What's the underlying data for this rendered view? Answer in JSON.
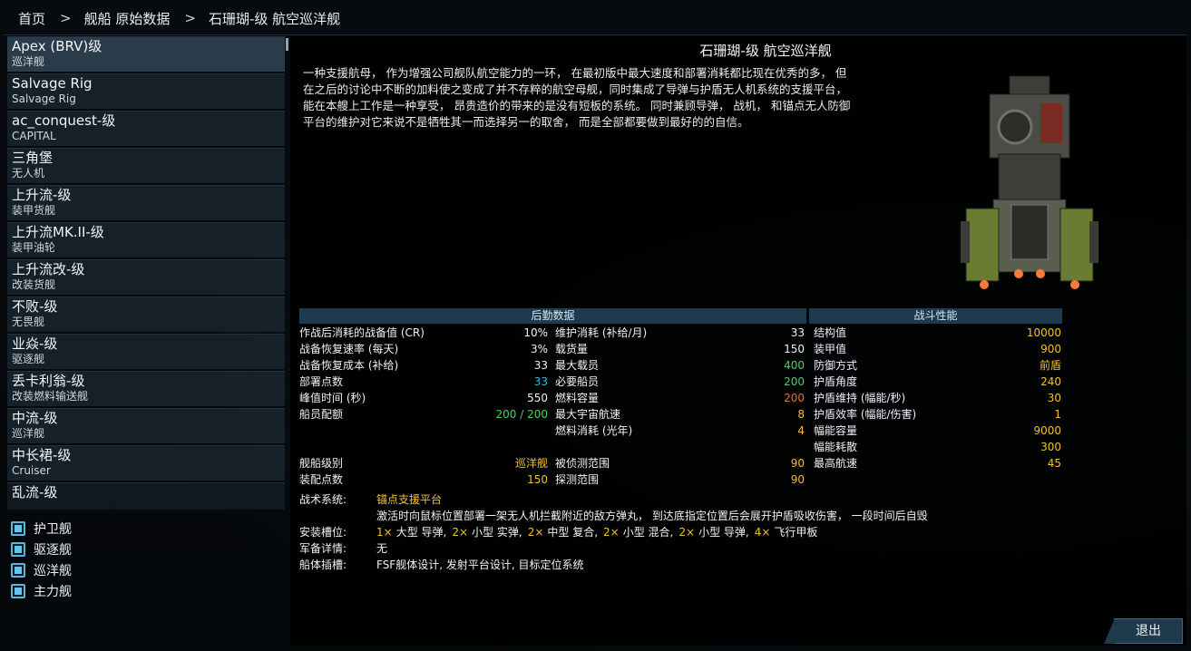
{
  "breadcrumb": {
    "home": "首页",
    "section": "舰船 原始数据",
    "current": "石珊瑚-级 航空巡洋舰",
    "sep": ">"
  },
  "ship_list": [
    {
      "name": "Apex (BRV)级",
      "class": "巡洋舰"
    },
    {
      "name": "Salvage Rig",
      "class": "Salvage Rig"
    },
    {
      "name": "ac_conquest-级",
      "class": "CAPITAL"
    },
    {
      "name": "三角堡",
      "class": "无人机"
    },
    {
      "name": "上升流-级",
      "class": "装甲货舰"
    },
    {
      "name": "上升流MK.II-级",
      "class": "装甲油轮"
    },
    {
      "name": "上升流改-级",
      "class": "改装货舰"
    },
    {
      "name": "不败-级",
      "class": "无畏舰"
    },
    {
      "name": "业焱-级",
      "class": "驱逐舰"
    },
    {
      "name": "丢卡利翁-级",
      "class": "改装燃料输送舰"
    },
    {
      "name": "中流-级",
      "class": "巡洋舰"
    },
    {
      "name": "中长裙-级",
      "class": "Cruiser"
    },
    {
      "name": "乱流-级",
      "class": ""
    }
  ],
  "filters": [
    "护卫舰",
    "驱逐舰",
    "巡洋舰",
    "主力舰"
  ],
  "ship": {
    "title": "石珊瑚-级 航空巡洋舰",
    "description": "一种支援航母， 作为增强公司舰队航空能力的一环， 在最初版中最大速度和部署消耗都比现在优秀的多， 但在之后的讨论中不断的加料使之变成了并不存粹的航空母舰，同时集成了导弹与护盾无人机系统的支援平台， 能在本艘上工作是一种享受， 昂贵造价的带来的是没有短板的系统。 同时兼顾导弹， 战机， 和锚点无人防御平台的维护对它来说不是牺牲其一而选择另一的取舍， 而是全部都要做到最好的的自信。"
  },
  "logistics_header": "后勤数据",
  "combat_header": "战斗性能",
  "logistics_col1": [
    {
      "label": "作战后消耗的战备值 (CR)",
      "value": "10%",
      "color": "#eef1f4"
    },
    {
      "label": "战备恢复速率 (每天)",
      "value": "3%",
      "color": "#eef1f4"
    },
    {
      "label": "战备恢复成本 (补给)",
      "value": "33",
      "color": "#eef1f4"
    },
    {
      "label": "  部署点数",
      "value": "33",
      "color": "#37b8dd"
    },
    {
      "label": "峰值时间 (秒)",
      "value": "550",
      "color": "#eef1f4"
    },
    {
      "label": "船员配额",
      "value": "200 / 200",
      "color": "#49d062"
    }
  ],
  "logistics_col2": [
    {
      "label": "维护消耗 (补给/月)",
      "value": "33",
      "color": "#eef1f4"
    },
    {
      "label": "载货量",
      "value": "150",
      "color": "#eef1f4"
    },
    {
      "label": "最大载员",
      "value": "400",
      "color": "#49d062"
    },
    {
      "label": "必要船员",
      "value": "200",
      "color": "#49d062"
    },
    {
      "label": "燃料容量",
      "value": "200",
      "color": "#ee6f2c"
    },
    {
      "label": "最大宇宙航速",
      "value": "8",
      "color": "#f2c12f"
    },
    {
      "label": "燃料消耗 (光年)",
      "value": "4",
      "color": "#f2c12f"
    }
  ],
  "logistics_col1_b": [
    {
      "label": "舰船级别",
      "value": "巡洋舰",
      "color": "#f2c12f"
    },
    {
      "label": "装配点数",
      "value": "150",
      "color": "#f2c12f"
    }
  ],
  "logistics_col2_b": [
    {
      "label": "被侦测范围",
      "value": "90",
      "color": "#f2c12f"
    },
    {
      "label": "探测范围",
      "value": "90",
      "color": "#f2c12f"
    }
  ],
  "combat": [
    {
      "label": "结构值",
      "value": "10000",
      "color": "#f2c12f"
    },
    {
      "label": "装甲值",
      "value": "900",
      "color": "#f2c12f"
    },
    {
      "label": "防御方式",
      "value": "前盾",
      "color": "#f2c12f"
    },
    {
      "label": "护盾角度",
      "value": "240",
      "color": "#f2c12f"
    },
    {
      "label": "护盾维持 (幅能/秒)",
      "value": "30",
      "color": "#f2c12f"
    },
    {
      "label": "护盾效率 (幅能/伤害)",
      "value": "1",
      "color": "#f2c12f"
    },
    {
      "label": "幅能容量",
      "value": "9000",
      "color": "#f2c12f"
    },
    {
      "label": "幅能耗散",
      "value": "300",
      "color": "#f2c12f"
    },
    {
      "label": "最高航速",
      "value": "45",
      "color": "#f2c12f"
    }
  ],
  "systems": {
    "tactical_label": "战术系统:",
    "tactical_name": "锚点支援平台",
    "tactical_desc": "激活时向鼠标位置部署一架无人机拦截附近的敌方弹丸， 到达底指定位置后会展开护盾吸收伤害， 一段时间后自毁",
    "slots_label": "安装槽位:",
    "slots": [
      {
        "count": "1×",
        "text": "大型 导弹,"
      },
      {
        "count": "2×",
        "text": "小型 实弹,"
      },
      {
        "count": "2×",
        "text": "中型 复合,"
      },
      {
        "count": "2×",
        "text": "小型 混合,"
      },
      {
        "count": "2×",
        "text": "小型 导弹,"
      },
      {
        "count": "4×",
        "text": "飞行甲板"
      }
    ],
    "armament_label": "军备详情:",
    "armament_value": "无",
    "hullmods_label": "船体插槽:",
    "hullmods_value": "FSF舰体设计, 发射平台设计, 目标定位系统"
  },
  "exit_label": "退出",
  "colors": {
    "accent": "#1d3a4e",
    "yellow": "#f2c12f",
    "green": "#49d062",
    "cyan": "#37b8dd",
    "orange": "#ee6f2c"
  }
}
